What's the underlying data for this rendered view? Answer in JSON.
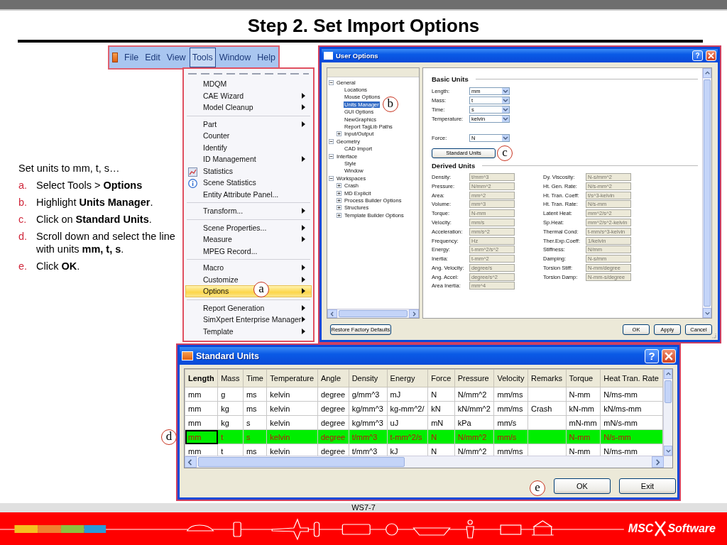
{
  "slide": {
    "title": "Step 2. Set Import Options",
    "page": "WS7-7",
    "logo": {
      "left": "MSC",
      "right": "Software"
    }
  },
  "instructions": {
    "intro": "Set units to mm, t, s…",
    "steps": [
      {
        "marker": "a.",
        "text": "Select Tools > **Options**"
      },
      {
        "marker": "b.",
        "text": "Highlight **Units Manager**."
      },
      {
        "marker": "c.",
        "text": "Click on **Standard Units**."
      },
      {
        "marker": "d.",
        "text": "Scroll down and select the line with units **mm, t, s**."
      },
      {
        "marker": "e.",
        "text": "Click **OK**."
      }
    ]
  },
  "menubar": {
    "items": [
      {
        "label": "File",
        "selected": false
      },
      {
        "label": "Edit",
        "selected": false
      },
      {
        "label": "View",
        "selected": false
      },
      {
        "label": "Tools",
        "selected": true
      },
      {
        "label": "Window",
        "selected": false
      },
      {
        "label": "Help",
        "selected": false
      }
    ]
  },
  "tools_menu": {
    "items": [
      {
        "kind": "item",
        "label": "MDQM",
        "submenu": false,
        "selected": false
      },
      {
        "kind": "item",
        "label": "CAE Wizard",
        "submenu": true,
        "selected": false
      },
      {
        "kind": "item",
        "label": "Model Cleanup",
        "submenu": true,
        "selected": false
      },
      {
        "kind": "separator"
      },
      {
        "kind": "item",
        "label": "Part",
        "submenu": true,
        "selected": false
      },
      {
        "kind": "item",
        "label": "Counter",
        "submenu": false,
        "selected": false
      },
      {
        "kind": "item",
        "label": "Identify",
        "submenu": false,
        "selected": false
      },
      {
        "kind": "item",
        "label": "ID Management",
        "submenu": true,
        "selected": false
      },
      {
        "kind": "chart-item",
        "label": "Statistics",
        "submenu": false,
        "selected": false
      },
      {
        "kind": "info-item",
        "label": "Scene Statistics",
        "submenu": false,
        "selected": false
      },
      {
        "kind": "item",
        "label": "Entity Attribute Panel...",
        "submenu": false,
        "selected": false
      },
      {
        "kind": "separator"
      },
      {
        "kind": "item",
        "label": "Transform...",
        "submenu": true,
        "selected": false
      },
      {
        "kind": "separator"
      },
      {
        "kind": "item",
        "label": "Scene Properties...",
        "submenu": true,
        "selected": false
      },
      {
        "kind": "item",
        "label": "Measure",
        "submenu": true,
        "selected": false
      },
      {
        "kind": "item",
        "label": "MPEG Record...",
        "submenu": false,
        "selected": false
      },
      {
        "kind": "separator"
      },
      {
        "kind": "item",
        "label": "Macro",
        "submenu": true,
        "selected": false
      },
      {
        "kind": "item",
        "label": "Customize",
        "submenu": true,
        "selected": false
      },
      {
        "kind": "item",
        "label": "Options",
        "submenu": true,
        "selected": true,
        "callout": "a"
      },
      {
        "kind": "separator"
      },
      {
        "kind": "item",
        "label": "Report Generation",
        "submenu": true,
        "selected": false
      },
      {
        "kind": "item",
        "label": "SimXpert Enterprise Manager",
        "submenu": true,
        "selected": false
      },
      {
        "kind": "item",
        "label": "Template",
        "submenu": true,
        "selected": false
      }
    ]
  },
  "user_options": {
    "title": "User Options",
    "help": "?",
    "tree": [
      {
        "label": "General",
        "expanded": true,
        "selected": false,
        "children": [
          {
            "label": "Locations",
            "selected": false
          },
          {
            "label": "Mouse Options",
            "selected": false
          },
          {
            "label": "Units Manager",
            "selected": true,
            "callout": "b"
          },
          {
            "label": "GUI Options",
            "selected": false
          },
          {
            "label": "NewGraphics",
            "selected": false
          },
          {
            "label": "Report TagLib Paths",
            "selected": false
          },
          {
            "label": "Input/Output",
            "expanded": false,
            "selected": false
          }
        ]
      },
      {
        "label": "Geometry",
        "expanded": true,
        "selected": false,
        "children": [
          {
            "label": "CAD Import",
            "selected": false
          }
        ]
      },
      {
        "label": "Interface",
        "expanded": true,
        "selected": false,
        "children": [
          {
            "label": "Style",
            "selected": false
          },
          {
            "label": "Window",
            "selected": false
          }
        ]
      },
      {
        "label": "Workspaces",
        "expanded": true,
        "selected": false,
        "children": [
          {
            "label": "Crash",
            "expanded": false,
            "selected": false
          },
          {
            "label": "MD Explicit",
            "expanded": false,
            "selected": false
          },
          {
            "label": "Process Builder Options",
            "expanded": false,
            "selected": false
          },
          {
            "label": "Structures",
            "expanded": false,
            "selected": false
          },
          {
            "label": "Template Builder Options",
            "expanded": false,
            "selected": false
          }
        ]
      }
    ],
    "basic_units": {
      "title": "Basic Units",
      "fields": [
        {
          "label": "Length:",
          "value": "mm"
        },
        {
          "label": "Mass:",
          "value": "t"
        },
        {
          "label": "Time:",
          "value": "s"
        },
        {
          "label": "Temperature:",
          "value": "kelvin"
        }
      ],
      "force": {
        "label": "Force:",
        "value": "N"
      },
      "standard_units_button": {
        "label": "Standard Units",
        "callout": "c"
      }
    },
    "derived_units": {
      "title": "Derived Units",
      "left": [
        {
          "label": "Density:",
          "value": "t/mm^3",
          "disabled": true
        },
        {
          "label": "Pressure:",
          "value": "N/mm^2",
          "disabled": true
        },
        {
          "label": "Area:",
          "value": "mm^2",
          "disabled": true
        },
        {
          "label": "Volume:",
          "value": "mm^3",
          "disabled": true
        },
        {
          "label": "Torque:",
          "value": "N-mm",
          "disabled": true
        },
        {
          "label": "Velocity:",
          "value": "mm/s",
          "disabled": true
        },
        {
          "label": "Acceleration:",
          "value": "mm/s^2",
          "disabled": true
        },
        {
          "label": "Frequency:",
          "value": "Hz",
          "disabled": true
        },
        {
          "label": "Energy:",
          "value": "t-mm^2/s^2",
          "disabled": true
        },
        {
          "label": "Inertia:",
          "value": "t-mm^2",
          "disabled": true
        },
        {
          "label": "Ang. Velocity:",
          "value": "degree/s",
          "disabled": true
        },
        {
          "label": "Ang. Accel:",
          "value": "degree/s^2",
          "disabled": true
        },
        {
          "label": "Area Inertia:",
          "value": "mm^4",
          "disabled": true
        }
      ],
      "right": [
        {
          "label": "Dy. Viscosity:",
          "value": "N-s/mm^2",
          "disabled": true
        },
        {
          "label": "Ht. Gen. Rate:",
          "value": "N/s-mm^2",
          "disabled": true
        },
        {
          "label": "Ht. Tran. Coeff:",
          "value": "t/s^3-kelvin",
          "disabled": true
        },
        {
          "label": "Ht. Tran. Rate:",
          "value": "N/s-mm",
          "disabled": true
        },
        {
          "label": "Latent Heat:",
          "value": "mm^2/s^2",
          "disabled": true
        },
        {
          "label": "Sp.Heat:",
          "value": "mm^2/s^2-kelvin",
          "disabled": true
        },
        {
          "label": "Thermal Cond:",
          "value": "t-mm/s^3-kelvin",
          "disabled": true
        },
        {
          "label": "Ther.Exp.Coeff:",
          "value": "1/kelvin",
          "disabled": true
        },
        {
          "label": "Stiffness:",
          "value": "N/mm",
          "disabled": true
        },
        {
          "label": "Damping:",
          "value": "N-s/mm",
          "disabled": true
        },
        {
          "label": "Torsion Stiff:",
          "value": "N-mm/degree",
          "disabled": true
        },
        {
          "label": "Torsion Damp:",
          "value": "N-mm-s/degree",
          "disabled": true
        }
      ]
    },
    "restore_button": "Restore Factory Defaults",
    "buttons": [
      "OK",
      "Apply",
      "Cancel"
    ]
  },
  "standard_units": {
    "title": "Standard Units",
    "help": "?",
    "columns": [
      {
        "label": "Length",
        "sorted": true
      },
      {
        "label": "Mass",
        "sorted": false
      },
      {
        "label": "Time",
        "sorted": false
      },
      {
        "label": "Temperature",
        "sorted": false
      },
      {
        "label": "Angle",
        "sorted": false
      },
      {
        "label": "Density",
        "sorted": false
      },
      {
        "label": "Energy",
        "sorted": false
      },
      {
        "label": "Force",
        "sorted": false
      },
      {
        "label": "Pressure",
        "sorted": false
      },
      {
        "label": "Velocity",
        "sorted": false
      },
      {
        "label": "Remarks",
        "sorted": false
      },
      {
        "label": "Torque",
        "sorted": false
      },
      {
        "label": "Heat Tran. Rate",
        "sorted": false
      }
    ],
    "rows": [
      {
        "selected": false,
        "cells": [
          "mm",
          "g",
          "ms",
          "kelvin",
          "degree",
          "g/mm^3",
          "mJ",
          "N",
          "N/mm^2",
          "mm/ms",
          null,
          "N-mm",
          "N/ms-mm"
        ]
      },
      {
        "selected": false,
        "cells": [
          "mm",
          "kg",
          "ms",
          "kelvin",
          "degree",
          "kg/mm^3",
          "kg-mm^2/",
          "kN",
          "kN/mm^2",
          "mm/ms",
          "Crash",
          "kN-mm",
          "kN/ms-mm"
        ]
      },
      {
        "selected": false,
        "cells": [
          "mm",
          "kg",
          "s",
          "kelvin",
          "degree",
          "kg/mm^3",
          "uJ",
          "mN",
          "kPa",
          "mm/s",
          null,
          "mN-mm",
          "mN/s-mm"
        ]
      },
      {
        "selected": true,
        "callout": "d",
        "cells": [
          "mm",
          "t",
          "s",
          "kelvin",
          "degree",
          "t/mm^3",
          "t-mm^2/s",
          "N",
          "N/mm^2",
          "mm/s",
          null,
          "N-mm",
          "N/s-mm"
        ]
      },
      {
        "selected": false,
        "cells": [
          "mm",
          "t",
          "ms",
          "kelvin",
          "degree",
          "t/mm^3",
          "kJ",
          "N",
          "N/mm^2",
          "mm/ms",
          null,
          "N-mm",
          "N/ms-mm"
        ]
      }
    ],
    "buttons": [
      {
        "label": "OK",
        "callout": "e"
      },
      {
        "label": "Exit"
      }
    ]
  }
}
